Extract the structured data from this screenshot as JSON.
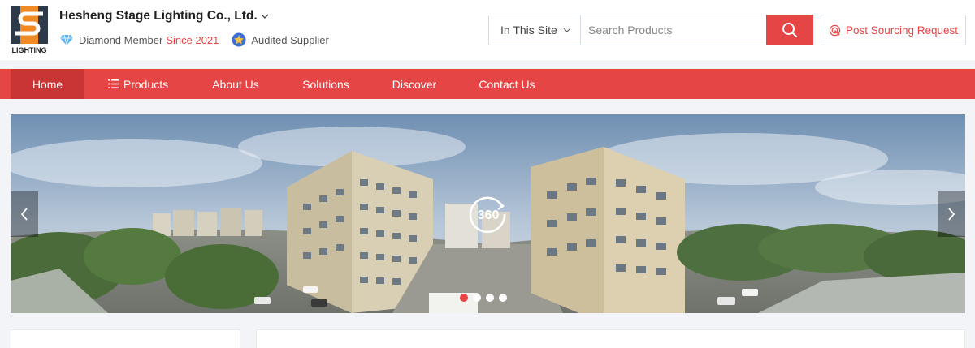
{
  "header": {
    "logo_text": "LIGHTING",
    "company_name": "Hesheng Stage Lighting Co., Ltd.",
    "member_label": "Diamond Member",
    "member_since": "Since 2021",
    "audited_label": "Audited Supplier"
  },
  "search": {
    "scope": "In This Site",
    "placeholder": "Search Products",
    "post_label": "Post Sourcing Request"
  },
  "nav": {
    "items": [
      {
        "label": "Home",
        "active": true
      },
      {
        "label": "Products",
        "icon": "list-icon"
      },
      {
        "label": "About Us"
      },
      {
        "label": "Solutions"
      },
      {
        "label": "Discover"
      },
      {
        "label": "Contact Us"
      }
    ]
  },
  "banner": {
    "icon": "360-icon",
    "slide_count": 4,
    "active_slide": 1
  },
  "colors": {
    "brand_red": "#e64545",
    "nav_active": "#c93535",
    "logo_orange": "#f08a24"
  }
}
